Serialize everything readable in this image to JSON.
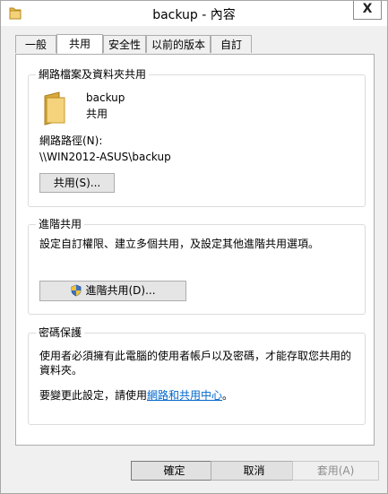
{
  "window": {
    "title": "backup - 內容",
    "close_symbol": "X"
  },
  "tabs": [
    {
      "label": "一般",
      "active": false
    },
    {
      "label": "共用",
      "active": true
    },
    {
      "label": "安全性",
      "active": false
    },
    {
      "label": "以前的版本",
      "active": false
    },
    {
      "label": "自訂",
      "active": false
    }
  ],
  "network_share": {
    "group_title": "網路檔案及資料夾共用",
    "folder_name": "backup",
    "folder_status": "共用",
    "path_label": "網路路徑(N):",
    "path_value": "\\\\WIN2012-ASUS\\backup",
    "share_button": "共用(S)..."
  },
  "advanced_share": {
    "group_title": "進階共用",
    "description": "設定自訂權限、建立多個共用，及設定其他進階共用選項。",
    "button": "進階共用(D)..."
  },
  "password_protection": {
    "group_title": "密碼保護",
    "line1": "使用者必須擁有此電腦的使用者帳戶以及密碼，才能存取您共用的",
    "line2": "資料夾。",
    "change_prefix": "要變更此設定，請使用",
    "change_link": "網路和共用中心",
    "change_suffix": "。"
  },
  "footer": {
    "ok": "確定",
    "cancel": "取消",
    "apply": "套用(A)"
  },
  "icons": {
    "title": "folder-icon",
    "folder": "folder-icon",
    "shield": "uac-shield-icon"
  }
}
